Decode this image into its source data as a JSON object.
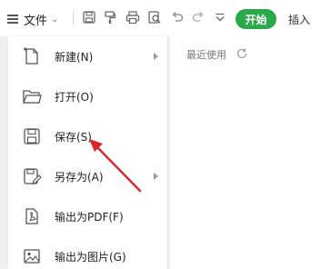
{
  "toolbar": {
    "menu_label": "文件",
    "start_label": "开始",
    "insert_label": "插入",
    "icons": [
      "save-icon",
      "format-painter-icon",
      "print-icon",
      "print-preview-icon",
      "undo-icon",
      "redo-icon",
      "more-icon"
    ]
  },
  "file_menu": {
    "items": [
      {
        "label": "新建(N)",
        "icon": "new-document-icon",
        "has_submenu": true
      },
      {
        "label": "打开(O)",
        "icon": "open-folder-icon",
        "has_submenu": false
      },
      {
        "label": "保存(S)",
        "icon": "save-icon",
        "has_submenu": false
      },
      {
        "label": "另存为(A)",
        "icon": "save-as-icon",
        "has_submenu": true
      },
      {
        "label": "输出为PDF(F)",
        "icon": "export-pdf-icon",
        "has_submenu": false
      },
      {
        "label": "输出为图片(G)",
        "icon": "export-image-icon",
        "has_submenu": false
      }
    ]
  },
  "recent": {
    "title": "最近使用"
  },
  "colors": {
    "accent_green": "#2aa84a",
    "annotation_red": "#d9262b"
  }
}
